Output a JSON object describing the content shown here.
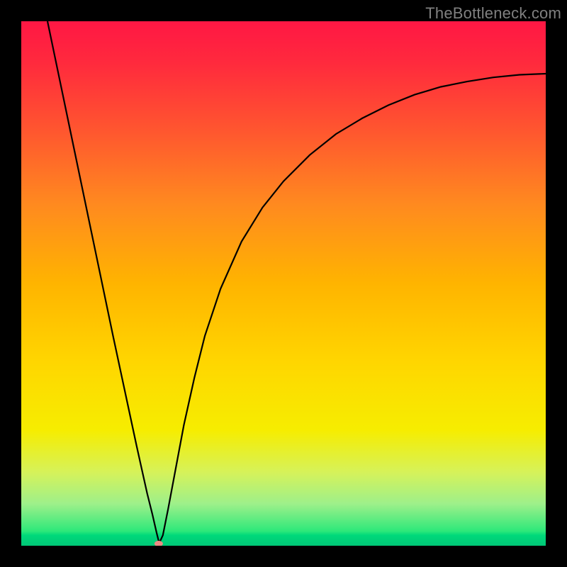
{
  "watermark": "TheBottleneck.com",
  "chart_data": {
    "type": "line",
    "title": "",
    "xlabel": "",
    "ylabel": "",
    "xlim": [
      0,
      100
    ],
    "ylim": [
      0,
      100
    ],
    "grid": false,
    "legend": false,
    "background_gradient": {
      "stops": [
        {
          "offset": 0.0,
          "color": "#ff1744"
        },
        {
          "offset": 0.08,
          "color": "#ff2a3d"
        },
        {
          "offset": 0.2,
          "color": "#ff5330"
        },
        {
          "offset": 0.35,
          "color": "#ff8a1f"
        },
        {
          "offset": 0.5,
          "color": "#ffb400"
        },
        {
          "offset": 0.65,
          "color": "#ffd600"
        },
        {
          "offset": 0.78,
          "color": "#f6ed00"
        },
        {
          "offset": 0.86,
          "color": "#d6f25a"
        },
        {
          "offset": 0.92,
          "color": "#9ef08a"
        },
        {
          "offset": 0.972,
          "color": "#2ee87a"
        },
        {
          "offset": 0.98,
          "color": "#00d97a"
        },
        {
          "offset": 1.0,
          "color": "#00c777"
        }
      ]
    },
    "series": [
      {
        "name": "curve",
        "color": "#000000",
        "x": [
          5.0,
          7.5,
          10.0,
          12.5,
          15.0,
          17.5,
          19.0,
          20.5,
          22.0,
          23.0,
          24.0,
          25.0,
          25.8,
          26.3,
          27.0,
          28.0,
          29.5,
          31.0,
          33.0,
          35.0,
          38.0,
          42.0,
          46.0,
          50.0,
          55.0,
          60.0,
          65.0,
          70.0,
          75.0,
          80.0,
          85.0,
          90.0,
          95.0,
          100.0
        ],
        "y": [
          100.0,
          88.0,
          76.0,
          64.0,
          52.0,
          40.0,
          33.0,
          26.0,
          19.0,
          14.5,
          10.0,
          6.0,
          2.5,
          0.5,
          2.0,
          7.0,
          15.0,
          23.0,
          32.0,
          40.0,
          49.0,
          58.0,
          64.5,
          69.5,
          74.5,
          78.5,
          81.5,
          84.0,
          86.0,
          87.5,
          88.5,
          89.3,
          89.8,
          90.0
        ]
      }
    ],
    "marker": {
      "name": "min-marker",
      "x": 26.2,
      "y": 0.4,
      "color": "#ea8b84",
      "rx": 6,
      "ry": 4
    }
  }
}
